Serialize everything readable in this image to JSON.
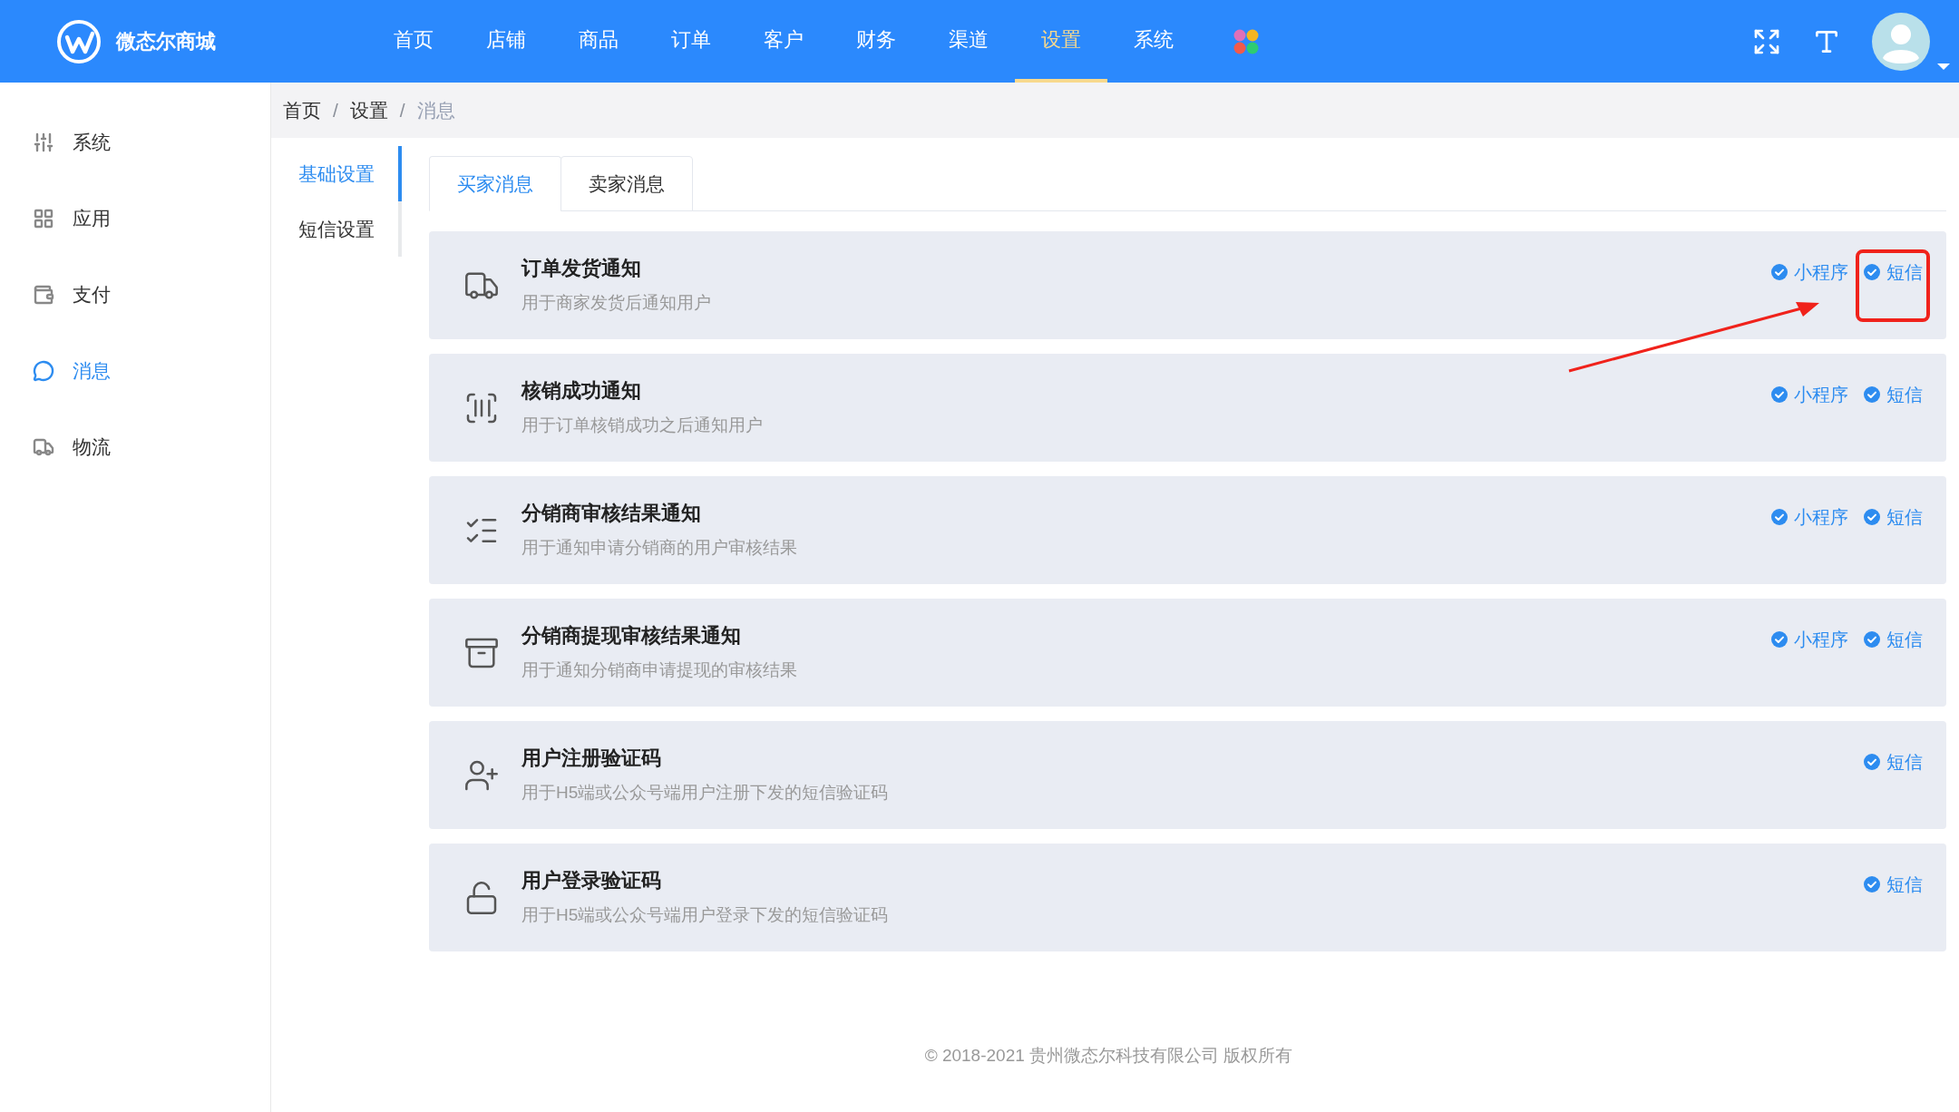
{
  "header": {
    "brand": "微态尔商城",
    "nav": [
      {
        "label": "首页",
        "selected": false
      },
      {
        "label": "店铺",
        "selected": false
      },
      {
        "label": "商品",
        "selected": false
      },
      {
        "label": "订单",
        "selected": false
      },
      {
        "label": "客户",
        "selected": false
      },
      {
        "label": "财务",
        "selected": false
      },
      {
        "label": "渠道",
        "selected": false
      },
      {
        "label": "设置",
        "selected": true
      },
      {
        "label": "系统",
        "selected": false
      }
    ]
  },
  "sidebar": {
    "items": [
      {
        "label": "系统",
        "selected": false
      },
      {
        "label": "应用",
        "selected": false
      },
      {
        "label": "支付",
        "selected": false
      },
      {
        "label": "消息",
        "selected": true
      },
      {
        "label": "物流",
        "selected": false
      }
    ]
  },
  "breadcrumb": {
    "separator": "/",
    "items": [
      "首页",
      "设置",
      "消息"
    ]
  },
  "submenu": [
    {
      "label": "基础设置",
      "selected": true
    },
    {
      "label": "短信设置",
      "selected": false
    }
  ],
  "tabs": [
    {
      "label": "买家消息",
      "selected": true
    },
    {
      "label": "卖家消息",
      "selected": false
    }
  ],
  "notifications": [
    {
      "title": "订单发货通知",
      "description": "用于商家发货后通知用户",
      "channels": [
        {
          "label": "小程序",
          "checked": true,
          "highlighted": false
        },
        {
          "label": "短信",
          "checked": true,
          "highlighted": true
        }
      ]
    },
    {
      "title": "核销成功通知",
      "description": "用于订单核销成功之后通知用户",
      "channels": [
        {
          "label": "小程序",
          "checked": true,
          "highlighted": false
        },
        {
          "label": "短信",
          "checked": true,
          "highlighted": false
        }
      ]
    },
    {
      "title": "分销商审核结果通知",
      "description": "用于通知申请分销商的用户审核结果",
      "channels": [
        {
          "label": "小程序",
          "checked": true,
          "highlighted": false
        },
        {
          "label": "短信",
          "checked": true,
          "highlighted": false
        }
      ]
    },
    {
      "title": "分销商提现审核结果通知",
      "description": "用于通知分销商申请提现的审核结果",
      "channels": [
        {
          "label": "小程序",
          "checked": true,
          "highlighted": false
        },
        {
          "label": "短信",
          "checked": true,
          "highlighted": false
        }
      ]
    },
    {
      "title": "用户注册验证码",
      "description": "用于H5端或公众号端用户注册下发的短信验证码",
      "channels": [
        {
          "label": "短信",
          "checked": true,
          "highlighted": false
        }
      ]
    },
    {
      "title": "用户登录验证码",
      "description": "用于H5端或公众号端用户登录下发的短信验证码",
      "channels": [
        {
          "label": "短信",
          "checked": true,
          "highlighted": false
        }
      ]
    }
  ],
  "footer": "© 2018-2021 贵州微态尔科技有限公司 版权所有"
}
